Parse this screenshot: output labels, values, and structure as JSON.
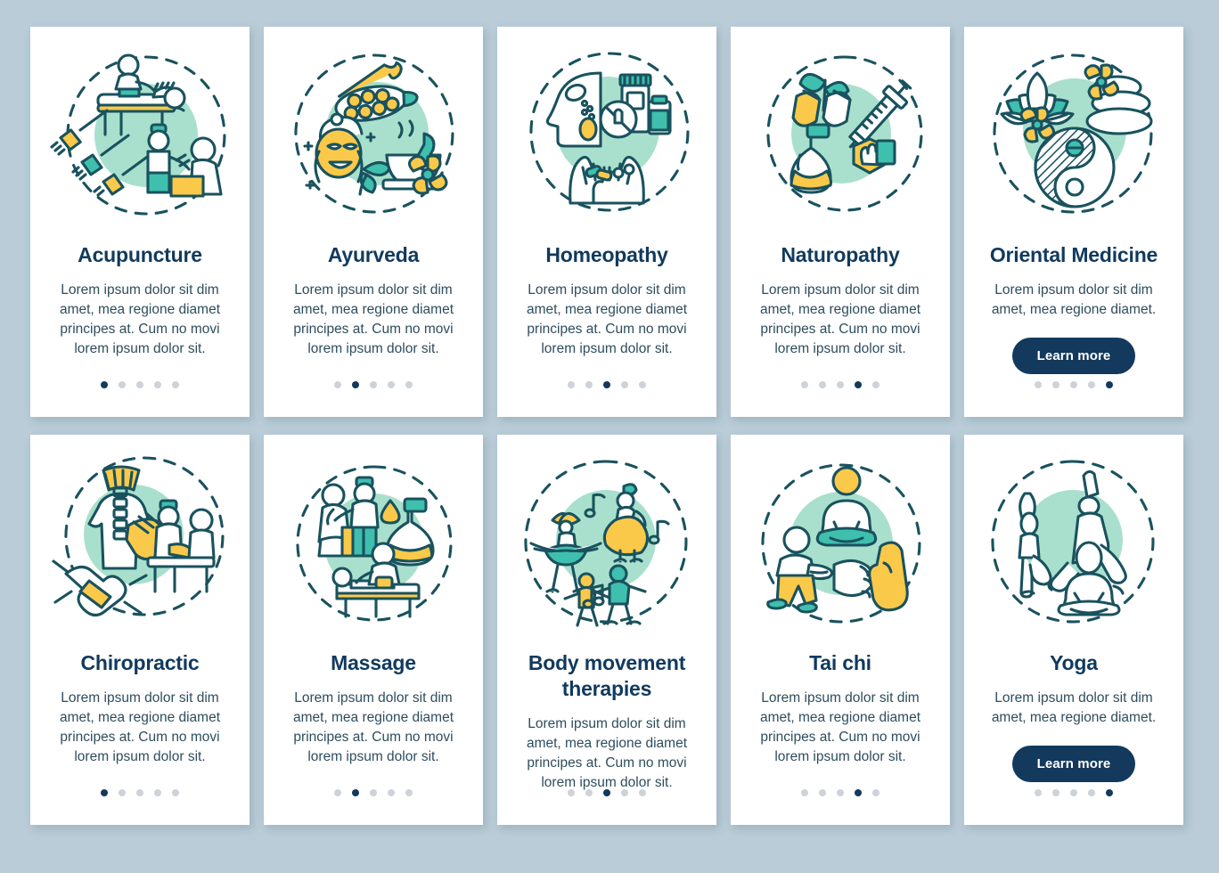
{
  "theme": {
    "background": "#b9ccd8",
    "card_background": "#ffffff",
    "title_color": "#113a5e",
    "body_color": "#2e4d5e",
    "accent_navy": "#13395c",
    "accent_teal": "#3fbfae",
    "accent_mint": "#a9e0cd",
    "accent_yellow": "#fbc94a",
    "dot_inactive": "#cdd3d8"
  },
  "common": {
    "learn_more_label": "Learn more",
    "description_long": "Lorem ipsum dolor sit dim amet, mea regione diamet principes at. Cum no movi lorem ipsum dolor sit.",
    "description_short": "Lorem ipsum dolor sit dim amet, mea regione diamet.",
    "dots_total": 5
  },
  "cards": [
    {
      "id": "acupuncture",
      "title": "Acupuncture",
      "description": "Lorem ipsum dolor sit dim amet, mea regione diamet principes at. Cum no movi lorem ipsum dolor sit.",
      "has_button": false,
      "active_dot": 0,
      "illustration": "acupuncture-illustration"
    },
    {
      "id": "ayurveda",
      "title": "Ayurveda",
      "description": "Lorem ipsum dolor sit dim amet, mea regione diamet principes at. Cum no movi lorem ipsum dolor sit.",
      "has_button": false,
      "active_dot": 1,
      "illustration": "ayurveda-illustration"
    },
    {
      "id": "homeopathy",
      "title": "Homeopathy",
      "description": "Lorem ipsum dolor sit dim amet, mea regione diamet principes at. Cum no movi lorem ipsum dolor sit.",
      "has_button": false,
      "active_dot": 2,
      "illustration": "homeopathy-illustration"
    },
    {
      "id": "naturopathy",
      "title": "Naturopathy",
      "description": "Lorem ipsum dolor sit dim amet, mea regione diamet principes at. Cum no movi lorem ipsum dolor sit.",
      "has_button": false,
      "active_dot": 3,
      "illustration": "naturopathy-illustration"
    },
    {
      "id": "oriental-medicine",
      "title": "Oriental Medicine",
      "description": "Lorem ipsum dolor sit dim amet, mea regione diamet.",
      "has_button": true,
      "button_label": "Learn more",
      "active_dot": 4,
      "illustration": "oriental-medicine-illustration"
    },
    {
      "id": "chiropractic",
      "title": "Chiropractic",
      "description": "Lorem ipsum dolor sit dim amet, mea regione diamet principes at. Cum no movi lorem ipsum dolor sit.",
      "has_button": false,
      "active_dot": 0,
      "illustration": "chiropractic-illustration"
    },
    {
      "id": "massage",
      "title": "Massage",
      "description": "Lorem ipsum dolor sit dim amet, mea regione diamet principes at. Cum no movi lorem ipsum dolor sit.",
      "has_button": false,
      "active_dot": 1,
      "illustration": "massage-illustration"
    },
    {
      "id": "body-movement-therapies",
      "title": "Body movement therapies",
      "description": "Lorem ipsum dolor sit dim amet, mea regione diamet principes at. Cum no movi lorem ipsum dolor sit.",
      "has_button": false,
      "active_dot": 2,
      "illustration": "body-movement-therapies-illustration"
    },
    {
      "id": "tai-chi",
      "title": "Tai chi",
      "description": "Lorem ipsum dolor sit dim amet, mea regione diamet principes at. Cum no movi lorem ipsum dolor sit.",
      "has_button": false,
      "active_dot": 3,
      "illustration": "tai-chi-illustration"
    },
    {
      "id": "yoga",
      "title": "Yoga",
      "description": "Lorem ipsum dolor sit dim amet, mea regione diamet.",
      "has_button": true,
      "button_label": "Learn more",
      "active_dot": 4,
      "illustration": "yoga-illustration"
    }
  ]
}
